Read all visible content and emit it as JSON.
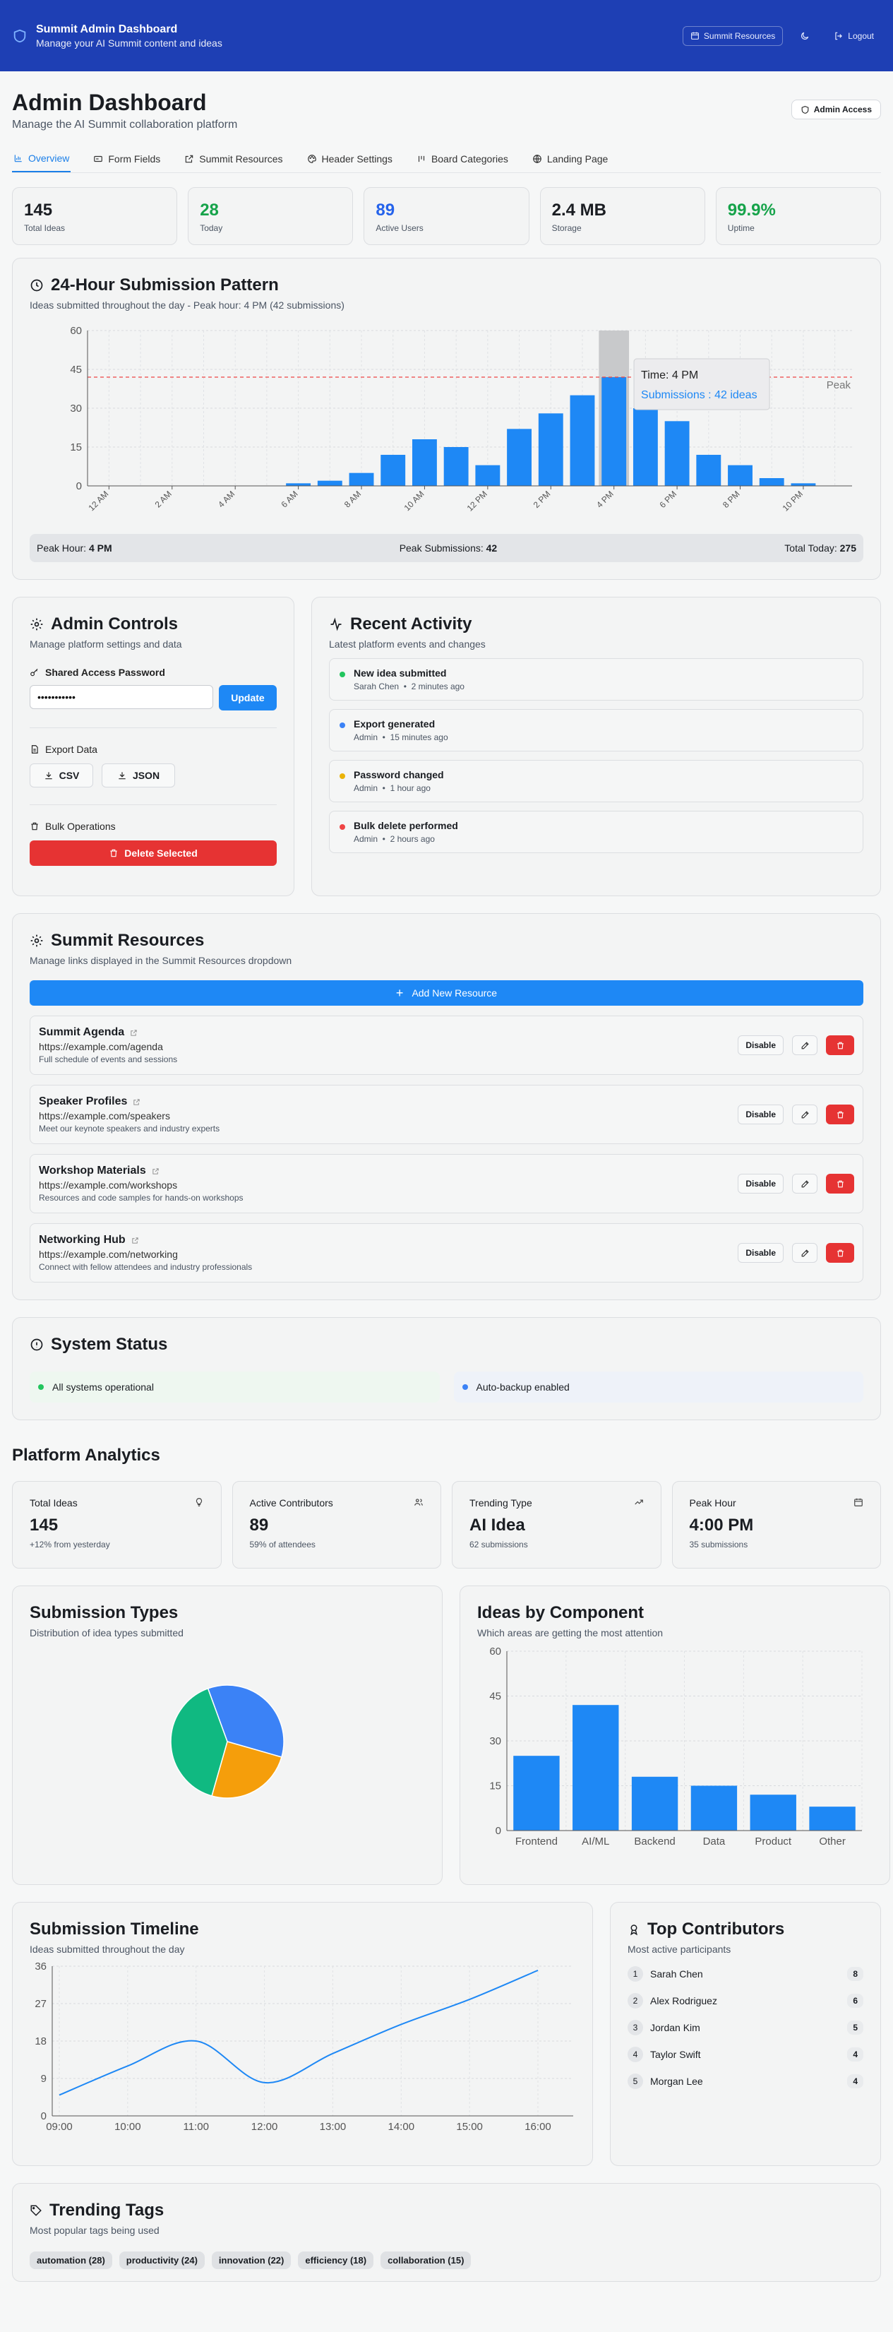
{
  "header": {
    "title": "Summit Admin Dashboard",
    "subtitle": "Manage your AI Summit content and ideas",
    "resources_label": "Summit Resources",
    "logout_label": "Logout"
  },
  "page": {
    "title": "Admin Dashboard",
    "subtitle": "Manage the AI Summit collaboration platform",
    "badge": "Admin Access"
  },
  "tabs": [
    {
      "label": "Overview",
      "icon": "bar-chart-icon"
    },
    {
      "label": "Form Fields",
      "icon": "form-icon"
    },
    {
      "label": "Summit Resources",
      "icon": "external-link-icon"
    },
    {
      "label": "Header Settings",
      "icon": "palette-icon"
    },
    {
      "label": "Board Categories",
      "icon": "kanban-icon"
    },
    {
      "label": "Landing Page",
      "icon": "globe-icon"
    }
  ],
  "stats": [
    {
      "value": "145",
      "label": "Total Ideas",
      "color": "#1a1d22"
    },
    {
      "value": "28",
      "label": "Today",
      "color": "#16a34a"
    },
    {
      "value": "89",
      "label": "Active Users",
      "color": "#2563eb"
    },
    {
      "value": "2.4 MB",
      "label": "Storage",
      "color": "#1a1d22"
    },
    {
      "value": "99.9%",
      "label": "Uptime",
      "color": "#16a34a"
    }
  ],
  "pattern": {
    "title": "24-Hour Submission Pattern",
    "desc": "Ideas submitted throughout the day - Peak hour: 4 PM (42 submissions)",
    "peak_label": "Peak",
    "tooltip_time": "Time: 4 PM",
    "tooltip_value": "Submissions : 42 ideas",
    "peak_hour_label": "Peak Hour:",
    "peak_hour": "4 PM",
    "peak_sub_label": "Peak Submissions:",
    "peak_sub": "42",
    "total_label": "Total Today:",
    "total": "275"
  },
  "admin": {
    "title": "Admin Controls",
    "desc": "Manage platform settings and data",
    "password_label": "Shared Access Password",
    "password_value": "•••••••••••",
    "update_label": "Update",
    "export_label": "Export Data",
    "csv_label": "CSV",
    "json_label": "JSON",
    "bulk_label": "Bulk Operations",
    "delete_label": "Delete Selected"
  },
  "activity": {
    "title": "Recent Activity",
    "desc": "Latest platform events and changes",
    "items": [
      {
        "title": "New idea submitted",
        "user": "Sarah Chen",
        "time": "2 minutes ago",
        "color": "#22c55e"
      },
      {
        "title": "Export generated",
        "user": "Admin",
        "time": "15 minutes ago",
        "color": "#3b82f6"
      },
      {
        "title": "Password changed",
        "user": "Admin",
        "time": "1 hour ago",
        "color": "#eab308"
      },
      {
        "title": "Bulk delete performed",
        "user": "Admin",
        "time": "2 hours ago",
        "color": "#ef4444"
      }
    ]
  },
  "resources": {
    "title": "Summit Resources",
    "desc": "Manage links displayed in the Summit Resources dropdown",
    "add_label": "Add New Resource",
    "disable_label": "Disable",
    "items": [
      {
        "name": "Summit Agenda",
        "url": "https://example.com/agenda",
        "desc": "Full schedule of events and sessions"
      },
      {
        "name": "Speaker Profiles",
        "url": "https://example.com/speakers",
        "desc": "Meet our keynote speakers and industry experts"
      },
      {
        "name": "Workshop Materials",
        "url": "https://example.com/workshops",
        "desc": "Resources and code samples for hands-on workshops"
      },
      {
        "name": "Networking Hub",
        "url": "https://example.com/networking",
        "desc": "Connect with fellow attendees and industry professionals"
      }
    ]
  },
  "system": {
    "title": "System Status",
    "items": [
      {
        "label": "All systems operational",
        "color": "#22c55e",
        "bg": "#eef7f0"
      },
      {
        "label": "Auto-backup enabled",
        "color": "#3b82f6",
        "bg": "#eef2f9"
      }
    ]
  },
  "analytics": {
    "title": "Platform Analytics",
    "cards": [
      {
        "label": "Total Ideas",
        "value": "145",
        "sub": "+12% from yesterday",
        "icon": "lightbulb-icon"
      },
      {
        "label": "Active Contributors",
        "value": "89",
        "sub": "59% of attendees",
        "icon": "users-icon"
      },
      {
        "label": "Trending Type",
        "value": "AI Idea",
        "sub": "62 submissions",
        "icon": "trending-up-icon"
      },
      {
        "label": "Peak Hour",
        "value": "4:00 PM",
        "sub": "35 submissions",
        "icon": "calendar-icon"
      }
    ]
  },
  "types": {
    "title": "Submission Types",
    "desc": "Distribution of idea types submitted"
  },
  "components": {
    "title": "Ideas by Component",
    "desc": "Which areas are getting the most attention"
  },
  "timeline": {
    "title": "Submission Timeline",
    "desc": "Ideas submitted throughout the day"
  },
  "contributors": {
    "title": "Top Contributors",
    "desc": "Most active participants",
    "items": [
      {
        "rank": "1",
        "name": "Sarah Chen",
        "count": "8"
      },
      {
        "rank": "2",
        "name": "Alex Rodriguez",
        "count": "6"
      },
      {
        "rank": "3",
        "name": "Jordan Kim",
        "count": "5"
      },
      {
        "rank": "4",
        "name": "Taylor Swift",
        "count": "4"
      },
      {
        "rank": "5",
        "name": "Morgan Lee",
        "count": "4"
      }
    ]
  },
  "tags": {
    "title": "Trending Tags",
    "desc": "Most popular tags being used",
    "items": [
      "automation (28)",
      "productivity (24)",
      "innovation (22)",
      "efficiency (18)",
      "collaboration (15)"
    ]
  },
  "chart_data": [
    {
      "type": "bar",
      "categories": [
        "12 AM",
        "1 AM",
        "2 AM",
        "3 AM",
        "4 AM",
        "5 AM",
        "6 AM",
        "7 AM",
        "8 AM",
        "9 AM",
        "10 AM",
        "11 AM",
        "12 PM",
        "1 PM",
        "2 PM",
        "3 PM",
        "4 PM",
        "5 PM",
        "6 PM",
        "7 PM",
        "8 PM",
        "9 PM",
        "10 PM",
        "11 PM"
      ],
      "values": [
        0,
        0,
        0,
        0,
        0,
        0,
        1,
        2,
        5,
        12,
        18,
        15,
        8,
        22,
        28,
        35,
        42,
        30,
        25,
        12,
        8,
        3,
        1,
        0
      ],
      "tick_labels": [
        "12 AM",
        "2 AM",
        "4 AM",
        "6 AM",
        "8 AM",
        "10 AM",
        "12 PM",
        "2 PM",
        "4 PM",
        "6 PM",
        "8 PM",
        "10 PM"
      ],
      "yticks": [
        0,
        15,
        30,
        45,
        60
      ],
      "ylim": [
        0,
        60
      ],
      "reference_line": 42,
      "highlight": "4 PM",
      "grid": true,
      "color": "#1e88f5"
    },
    {
      "type": "pie",
      "values": [
        35,
        25,
        40
      ],
      "colors": [
        "#3b82f6",
        "#f59e0b",
        "#10b981"
      ]
    },
    {
      "type": "bar",
      "categories": [
        "Frontend",
        "AI/ML",
        "Backend",
        "Data",
        "Product",
        "Other"
      ],
      "values": [
        25,
        42,
        18,
        15,
        12,
        8
      ],
      "yticks": [
        0,
        15,
        30,
        45,
        60
      ],
      "ylim": [
        0,
        60
      ],
      "grid": true,
      "color": "#1e88f5"
    },
    {
      "type": "line",
      "x": [
        "09:00",
        "10:00",
        "11:00",
        "12:00",
        "13:00",
        "14:00",
        "15:00",
        "16:00"
      ],
      "values": [
        5,
        12,
        18,
        8,
        15,
        22,
        28,
        35
      ],
      "yticks": [
        0,
        9,
        18,
        27,
        36
      ],
      "ylim": [
        0,
        36
      ],
      "grid": true,
      "color": "#1e88f5"
    }
  ]
}
